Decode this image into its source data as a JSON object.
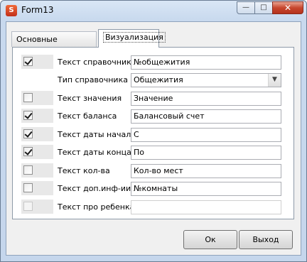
{
  "window": {
    "title": "Form13",
    "app_icon_text": "S",
    "minimize_glyph": "—",
    "maximize_glyph": "□",
    "close_glyph": "✕"
  },
  "tabs": [
    {
      "label": "Основные сведения",
      "active": false
    },
    {
      "label": "Визуализация",
      "active": true
    }
  ],
  "rows": [
    {
      "label": "Текст справочника",
      "checked": true,
      "enabled": true,
      "value": "№общежития"
    },
    {
      "label": "Тип справочника",
      "select_value": "Общежития"
    },
    {
      "label": "Текст значения",
      "checked": false,
      "enabled": true,
      "value": "Значение"
    },
    {
      "label": "Текст баланса",
      "checked": true,
      "enabled": true,
      "value": "Балансовый счет"
    },
    {
      "label": "Текст даты начала",
      "checked": true,
      "enabled": true,
      "value": "С"
    },
    {
      "label": "Текст даты конца",
      "checked": true,
      "enabled": true,
      "value": "По"
    },
    {
      "label": "Текст кол-ва",
      "checked": false,
      "enabled": true,
      "value": "Кол-во мест"
    },
    {
      "label": "Текст доп.инф-ии",
      "checked": false,
      "enabled": true,
      "value": "№комнаты"
    },
    {
      "label": "Текст про ребенка",
      "checked": false,
      "enabled": false,
      "value": ""
    }
  ],
  "buttons": {
    "ok": "Ок",
    "exit": "Выход"
  },
  "icons": {
    "dropdown": "chevron-down-icon"
  }
}
